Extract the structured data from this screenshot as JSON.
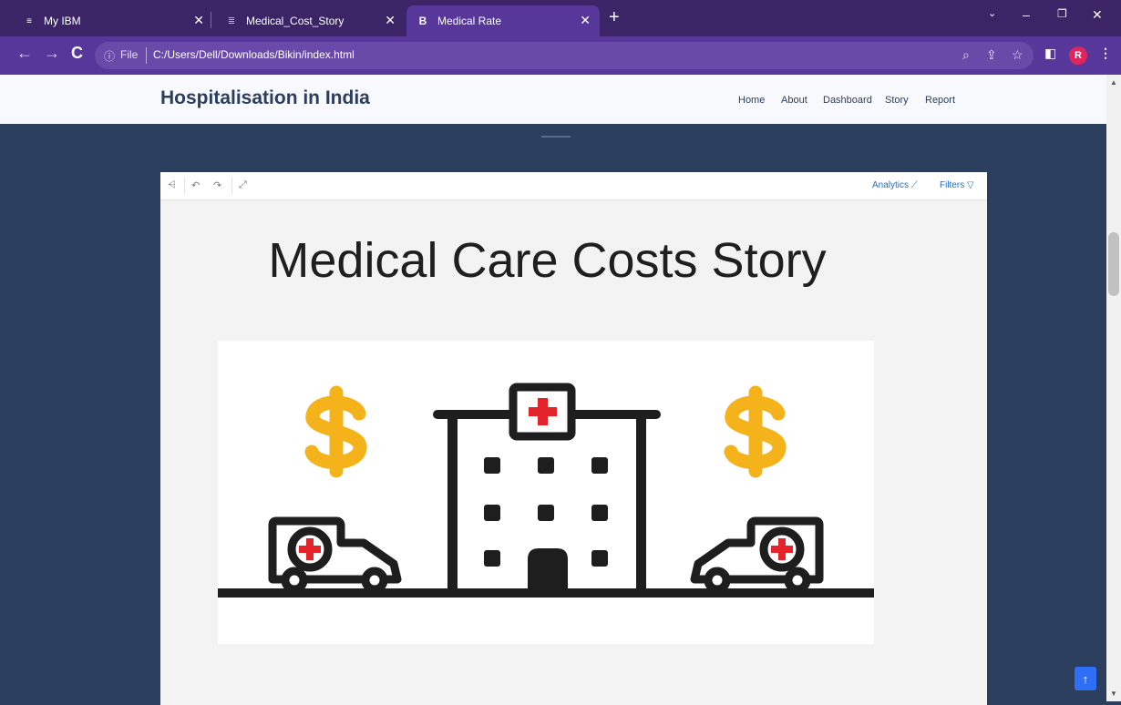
{
  "browser": {
    "tabs": [
      {
        "title": "My IBM",
        "favicon": "ibm-logo"
      },
      {
        "title": "Medical_Cost_Story",
        "favicon": "doc-lines"
      },
      {
        "title": "Medical Rate",
        "favicon": "B"
      }
    ],
    "file_label": "File",
    "url": "C:/Users/Dell/Downloads/Bikin/index.html",
    "profile_initial": "R"
  },
  "site": {
    "brand": "Hospitalisation in India",
    "nav": [
      "Home",
      "About",
      "Dashboard",
      "Story",
      "Report"
    ]
  },
  "story": {
    "toolbar": {
      "analytics": "Analytics",
      "filters": "Filters"
    },
    "title": "Medical Care Costs Story"
  },
  "colors": {
    "accent": "#2f6ff7",
    "brand": "#2c3e5d",
    "dollar": "#f4b21b",
    "cross": "#e3242b"
  }
}
